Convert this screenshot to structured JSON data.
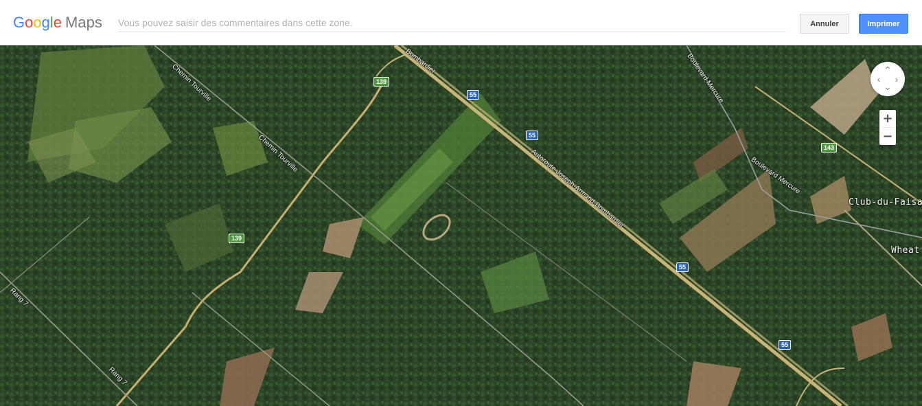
{
  "header": {
    "logo": {
      "letters": [
        "G",
        "o",
        "o",
        "g",
        "l",
        "e"
      ],
      "product": "Maps"
    },
    "comment_placeholder": "Vous pouvez saisir des commentaires dans cette zone.",
    "cancel_label": "Annuler",
    "print_label": "Imprimer"
  },
  "map": {
    "view": "satellite",
    "route_shields": {
      "r139_top": "139",
      "r139_mid": "139",
      "r143": "143",
      "a55_1": "55",
      "a55_2": "55",
      "a55_3": "55",
      "a55_4": "55"
    },
    "road_labels": {
      "bombardier_top": "Bombardier",
      "chemin_tourville_1": "Chemin Tourville",
      "chemin_tourville_2": "Chemin Tourville",
      "autoroute": "Autoroute-Joseph-Armand-Bombardier",
      "boulevard_mercure_1": "Boulevard Mercure",
      "boulevard_mercure_2": "Boulevard Mercure",
      "rang7_1": "Rang 7",
      "rang7_2": "Rang 7"
    },
    "place_labels": {
      "club": "Club-du-Faisan",
      "wheat": "Wheat"
    },
    "controls": {
      "nav_up": "⌃",
      "nav_left": "‹",
      "nav_right": "›",
      "nav_down": "⌄",
      "zoom_in": "+",
      "zoom_out": "−"
    },
    "colors": {
      "shield_blue": "#2a62b6",
      "shield_green": "#4b9b3b",
      "print_button": "#4d90fe"
    }
  }
}
